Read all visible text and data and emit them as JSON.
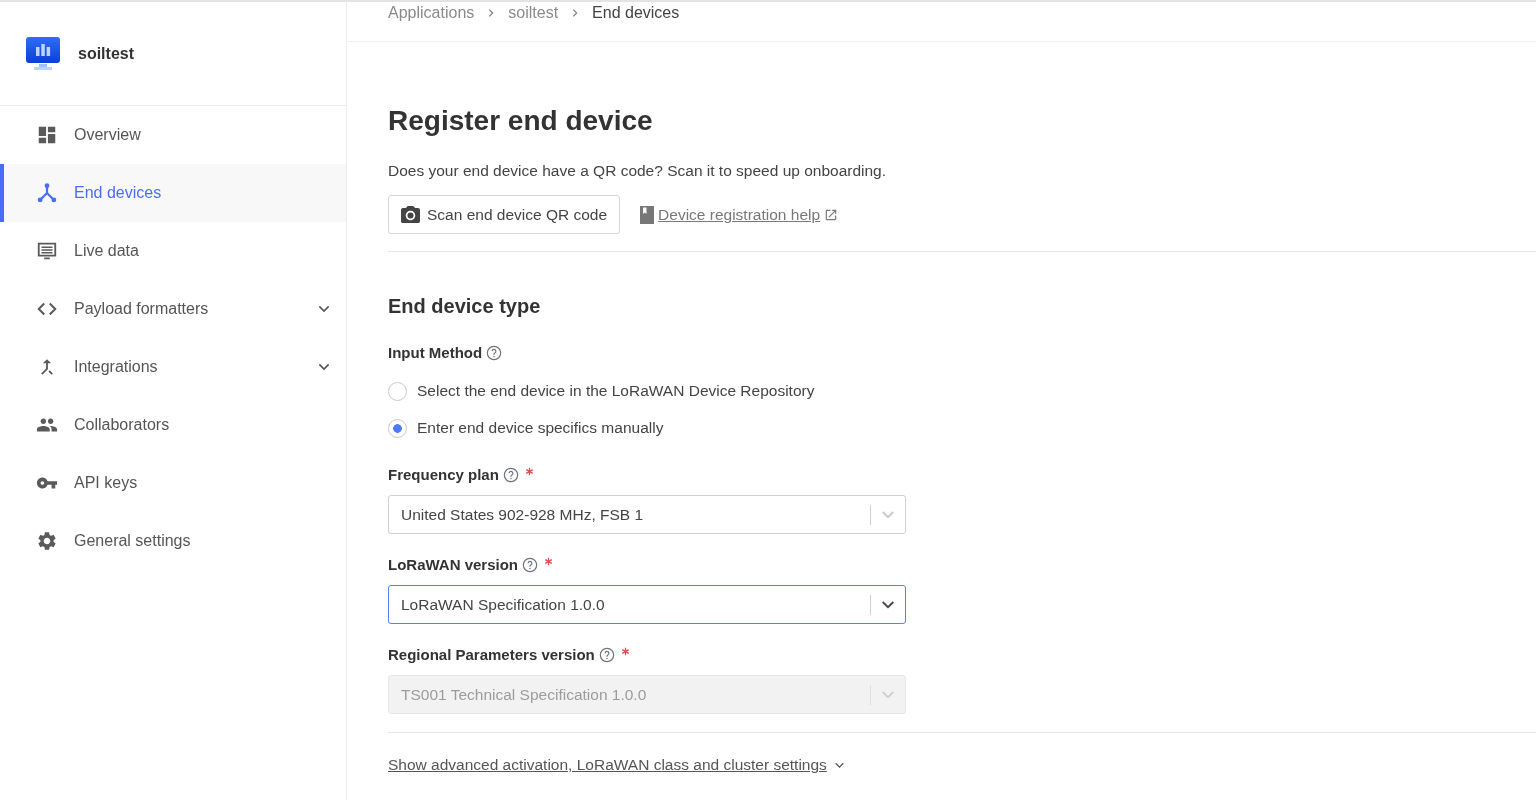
{
  "sidebar": {
    "app_name": "soiltest",
    "items": [
      {
        "label": "Overview",
        "kind": "link",
        "selected": false
      },
      {
        "label": "End devices",
        "kind": "link",
        "selected": true
      },
      {
        "label": "Live data",
        "kind": "link",
        "selected": false
      },
      {
        "label": "Payload formatters",
        "kind": "group",
        "selected": false,
        "expanded": false
      },
      {
        "label": "Integrations",
        "kind": "group",
        "selected": false,
        "expanded": false
      },
      {
        "label": "Collaborators",
        "kind": "link",
        "selected": false
      },
      {
        "label": "API keys",
        "kind": "link",
        "selected": false
      },
      {
        "label": "General settings",
        "kind": "link",
        "selected": false
      }
    ]
  },
  "breadcrumb": [
    {
      "label": "Applications",
      "current": false
    },
    {
      "label": "soiltest",
      "current": false
    },
    {
      "label": "End devices",
      "current": true
    }
  ],
  "page": {
    "title": "Register end device",
    "qr_prompt": "Does your end device have a QR code? Scan it to speed up onboarding.",
    "scan_button": "Scan end device QR code",
    "help_link": "Device registration help"
  },
  "device_type": {
    "heading": "End device type",
    "input_method": {
      "label": "Input Method",
      "options": [
        {
          "label": "Select the end device in the LoRaWAN Device Repository",
          "selected": false
        },
        {
          "label": "Enter end device specifics manually",
          "selected": true
        }
      ]
    },
    "fields": [
      {
        "label": "Frequency plan",
        "required": true,
        "value": "United States 902-928 MHz, FSB 1",
        "focused": false,
        "disabled": false
      },
      {
        "label": "LoRaWAN version",
        "required": true,
        "value": "LoRaWAN Specification 1.0.0",
        "focused": true,
        "disabled": false
      },
      {
        "label": "Regional Parameters version",
        "required": true,
        "value": "TS001 Technical Specification 1.0.0",
        "focused": false,
        "disabled": true
      }
    ]
  },
  "advanced_link": "Show advanced activation, LoRaWAN class and cluster settings"
}
